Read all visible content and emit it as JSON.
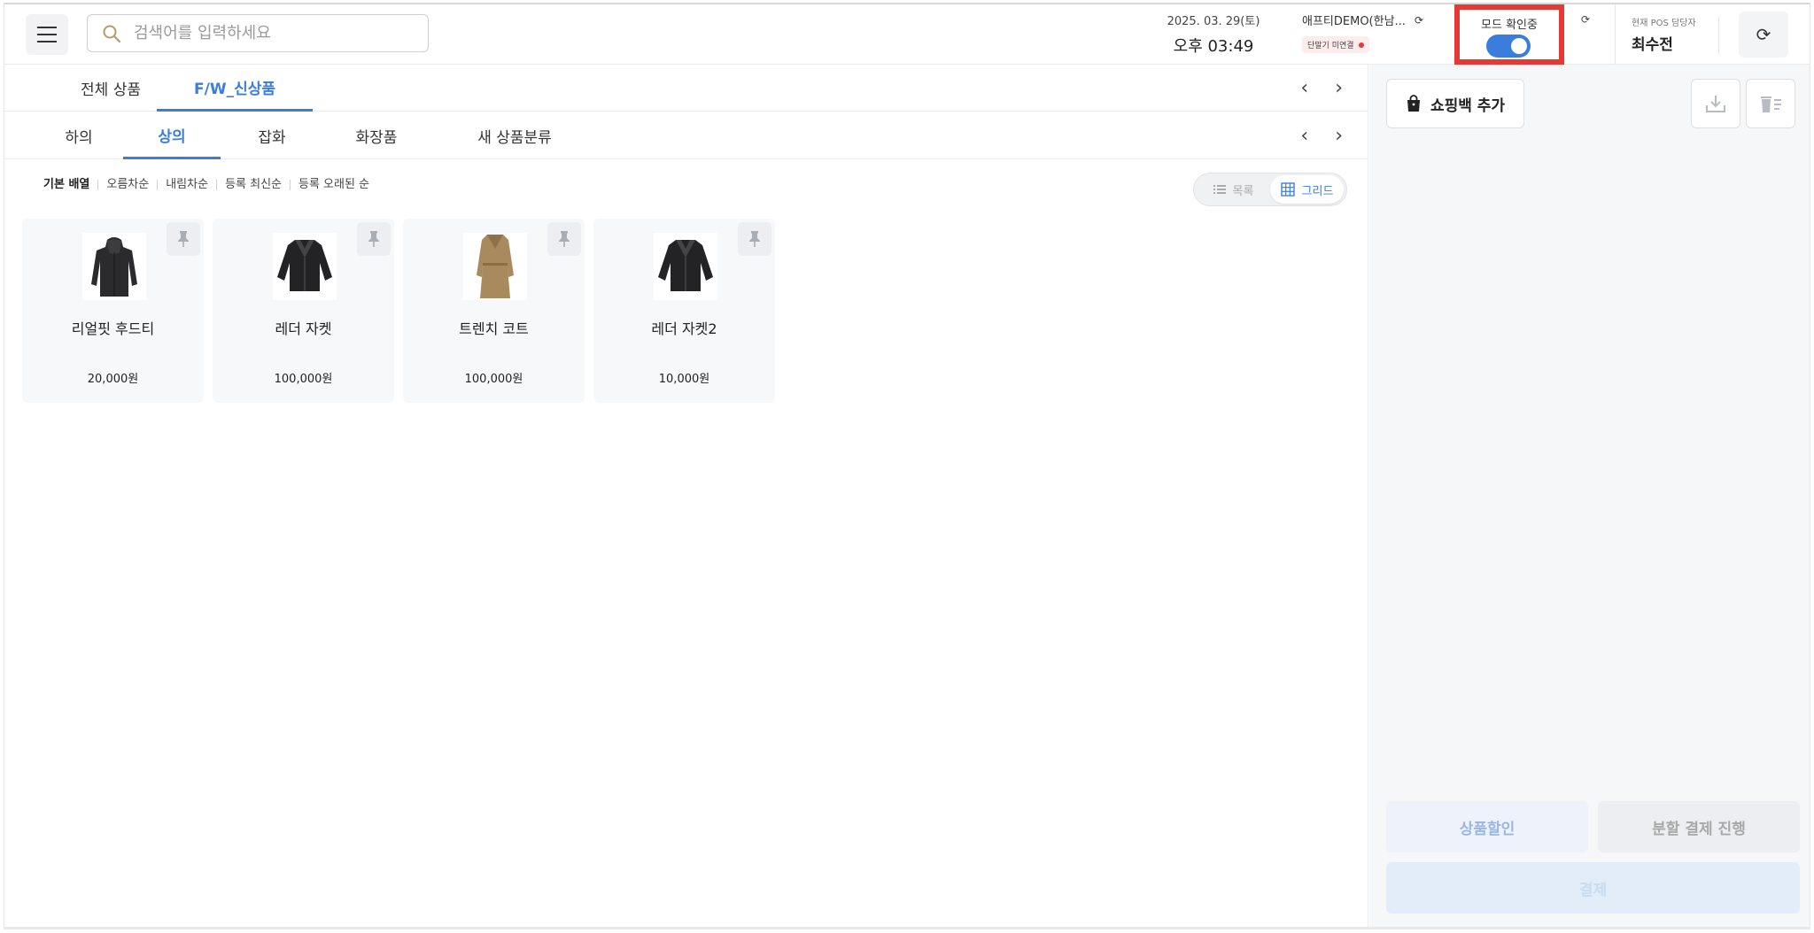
{
  "header": {
    "menu_icon": "hamburger-menu-icon",
    "search_placeholder": "검색어를 입력하세요",
    "date": "2025. 03. 29(토)",
    "time": "오후 03:49",
    "store_name": "애프티DEMO(한남...",
    "terminal_status": "단말기 미연결",
    "mode_label": "모드 확인중",
    "mode_enabled": true,
    "pos_manager_label": "현재 POS 담당자",
    "pos_manager_name": "최수전"
  },
  "category_tabs": {
    "items": [
      "전체 상품",
      "F/W_신상품"
    ],
    "active": "F/W_신상품"
  },
  "subcategory_tabs": {
    "items": [
      "하의",
      "상의",
      "잡화",
      "화장품",
      "새 상품분류"
    ],
    "active": "상의"
  },
  "sort_options": [
    "기본 배열",
    "오름차순",
    "내림차순",
    "등록 최신순",
    "등록 오래된 순"
  ],
  "view_toggle": {
    "list_label": "목록",
    "grid_label": "그리드",
    "active": "그리드"
  },
  "products": [
    {
      "name": "리얼핏 후드티",
      "price": "20,000원",
      "image": "hoodie-black"
    },
    {
      "name": "레더 자켓",
      "price": "100,000원",
      "image": "leather-jacket"
    },
    {
      "name": "트렌치 코트",
      "price": "100,000원",
      "image": "trench-coat"
    },
    {
      "name": "레더 자켓2",
      "price": "10,000원",
      "image": "leather-jacket"
    }
  ],
  "cart": {
    "add_bag_label": "쇼핑백 추가",
    "discount_label": "상품할인",
    "split_payment_label": "분할 결제 진행",
    "pay_label": "결제"
  },
  "colors": {
    "accent": "#3b7ddd",
    "highlight": "#e53935"
  }
}
